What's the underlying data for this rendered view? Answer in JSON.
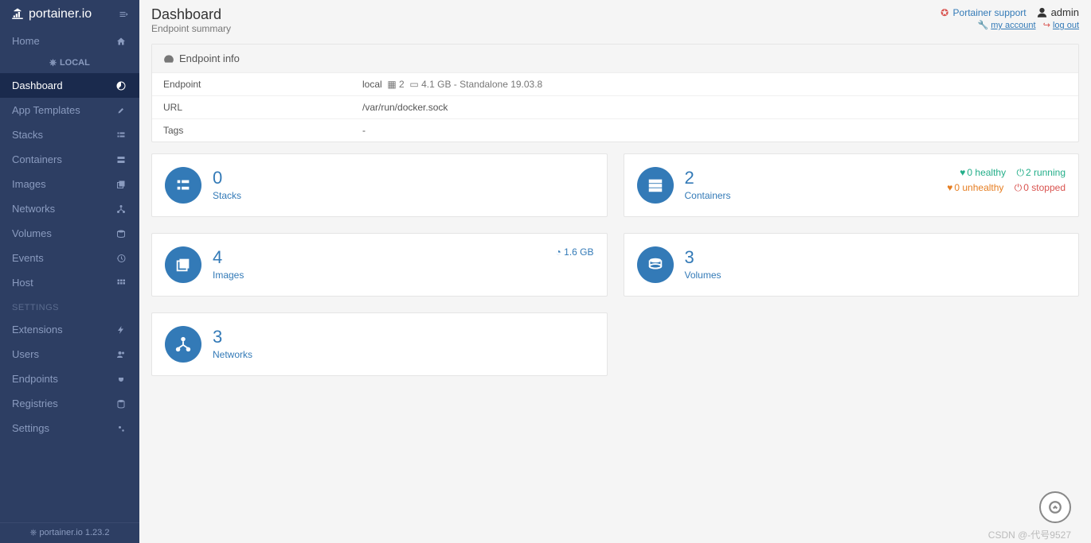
{
  "brand": "portainer.io",
  "sidebar": {
    "home": "Home",
    "local_label": "LOCAL",
    "items": [
      {
        "label": "Dashboard",
        "active": true
      },
      {
        "label": "App Templates"
      },
      {
        "label": "Stacks"
      },
      {
        "label": "Containers"
      },
      {
        "label": "Images"
      },
      {
        "label": "Networks"
      },
      {
        "label": "Volumes"
      },
      {
        "label": "Events"
      },
      {
        "label": "Host"
      }
    ],
    "settings_head": "SETTINGS",
    "settings": [
      {
        "label": "Extensions"
      },
      {
        "label": "Users"
      },
      {
        "label": "Endpoints"
      },
      {
        "label": "Registries"
      },
      {
        "label": "Settings"
      }
    ],
    "footer": "portainer.io 1.23.2"
  },
  "header": {
    "title": "Dashboard",
    "subtitle": "Endpoint summary",
    "support": "Portainer support",
    "user": "admin",
    "my_account": "my account",
    "log_out": "log out"
  },
  "endpoint_panel": {
    "title": "Endpoint info",
    "rows": {
      "endpoint_label": "Endpoint",
      "endpoint_name": "local",
      "cpu": "2",
      "mem": "4.1 GB",
      "mode": "Standalone 19.03.8",
      "url_label": "URL",
      "url_value": "/var/run/docker.sock",
      "tags_label": "Tags",
      "tags_value": "-"
    }
  },
  "tiles": {
    "stacks": {
      "count": "0",
      "label": "Stacks"
    },
    "containers": {
      "count": "2",
      "label": "Containers",
      "healthy": "0 healthy",
      "unhealthy": "0 unhealthy",
      "running": "2 running",
      "stopped": "0 stopped"
    },
    "images": {
      "count": "4",
      "label": "Images",
      "size": "1.6 GB"
    },
    "volumes": {
      "count": "3",
      "label": "Volumes"
    },
    "networks": {
      "count": "3",
      "label": "Networks"
    }
  },
  "watermark": "CSDN @-代号9527"
}
